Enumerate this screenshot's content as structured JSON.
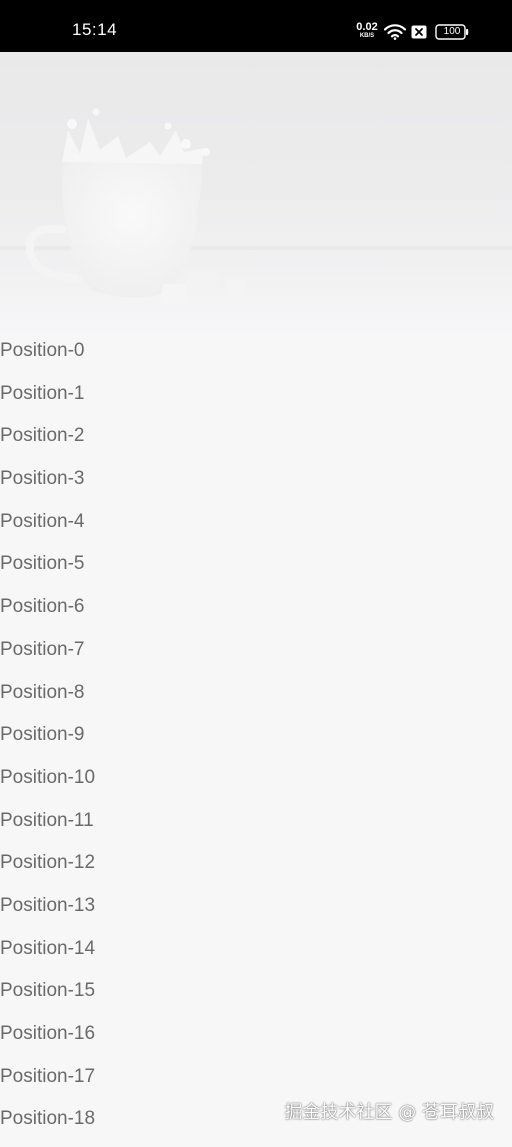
{
  "status_bar": {
    "time": "15:14",
    "net_speed_value": "0.02",
    "net_speed_unit": "KB/S",
    "battery_level": "100",
    "icons": [
      "wifi-icon",
      "sim-icon",
      "battery-icon"
    ]
  },
  "header": {
    "image_subject": "milk-splash-cup-image"
  },
  "list": {
    "items": [
      "Position-0",
      "Position-1",
      "Position-2",
      "Position-3",
      "Position-4",
      "Position-5",
      "Position-6",
      "Position-7",
      "Position-8",
      "Position-9",
      "Position-10",
      "Position-11",
      "Position-12",
      "Position-13",
      "Position-14",
      "Position-15",
      "Position-16",
      "Position-17",
      "Position-18"
    ]
  },
  "watermark": {
    "text": "掘金技术社区 @ 苍耳叔叔"
  },
  "colors": {
    "status_bar_bg": "#000000",
    "page_bg": "#f7f7f8",
    "list_text": "#6a6a6a"
  }
}
